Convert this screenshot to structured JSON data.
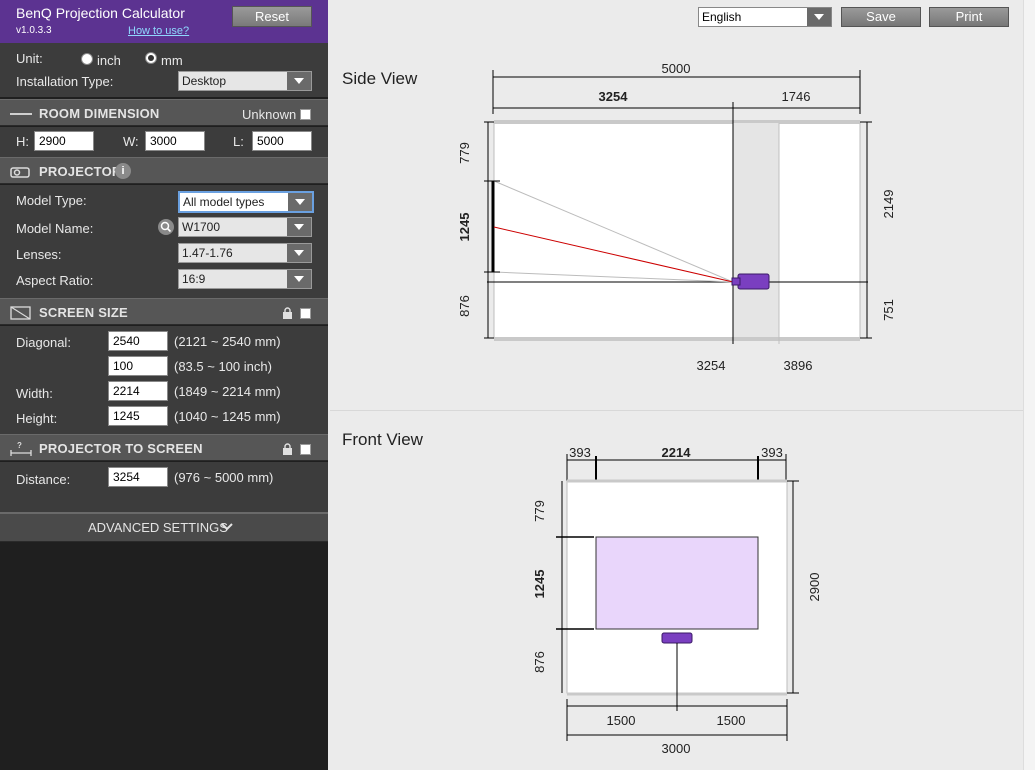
{
  "app": {
    "title": "BenQ Projection Calculator",
    "version": "v1.0.3.3",
    "how_to_use": "How to use?",
    "reset_label": "Reset"
  },
  "settings": {
    "unit_label": "Unit:",
    "unit_inch": "inch",
    "unit_mm": "mm",
    "unit_selected": "mm",
    "install_label": "Installation Type:",
    "install_value": "Desktop"
  },
  "room": {
    "title": "ROOM DIMENSION",
    "unknown_label": "Unknown",
    "h_label": "H:",
    "h_value": "2900",
    "w_label": "W:",
    "w_value": "3000",
    "l_label": "L:",
    "l_value": "5000"
  },
  "projector": {
    "title": "PROJECTOR",
    "model_type_label": "Model Type:",
    "model_type_value": "All model types",
    "model_name_label": "Model Name:",
    "model_name_value": "W1700",
    "lenses_label": "Lenses:",
    "lenses_value": "1.47-1.76",
    "aspect_label": "Aspect Ratio:",
    "aspect_value": "16:9"
  },
  "screen": {
    "title": "SCREEN SIZE",
    "diagonal_label": "Diagonal:",
    "diagonal_mm": "2540",
    "diagonal_mm_range": "(2121 ~ 2540 mm)",
    "diagonal_inch": "100",
    "diagonal_inch_range": "(83.5 ~ 100 inch)",
    "width_label": "Width:",
    "width_value": "2214",
    "width_range": "(1849 ~ 2214 mm)",
    "height_label": "Height:",
    "height_value": "1245",
    "height_range": "(1040 ~ 1245 mm)"
  },
  "distance": {
    "title": "PROJECTOR TO SCREEN",
    "label": "Distance:",
    "value": "3254",
    "range": "(976 ~ 5000 mm)"
  },
  "advanced": {
    "label": "ADVANCED SETTINGS"
  },
  "toolbar": {
    "language": "English",
    "save_label": "Save",
    "print_label": "Print"
  },
  "side_view": {
    "title": "Side View",
    "total_length": "5000",
    "dist_to_projector": "3254",
    "remaining": "1746",
    "top_gap": "779",
    "screen_height": "1245",
    "bottom_gap": "876",
    "right_top": "2149",
    "right_bottom": "751",
    "pos_a": "3254",
    "pos_b": "3896"
  },
  "front_view": {
    "title": "Front View",
    "left_gap": "393",
    "screen_width": "2214",
    "right_gap": "393",
    "top_gap": "779",
    "screen_height": "1245",
    "bottom_gap": "876",
    "room_height": "2900",
    "half_left": "1500",
    "half_right": "1500",
    "room_width": "3000"
  },
  "colors": {
    "accent": "#5c3391",
    "projector": "#7a3fc0",
    "screen_fill": "#e9d6fb",
    "beam": "#cc0000"
  }
}
